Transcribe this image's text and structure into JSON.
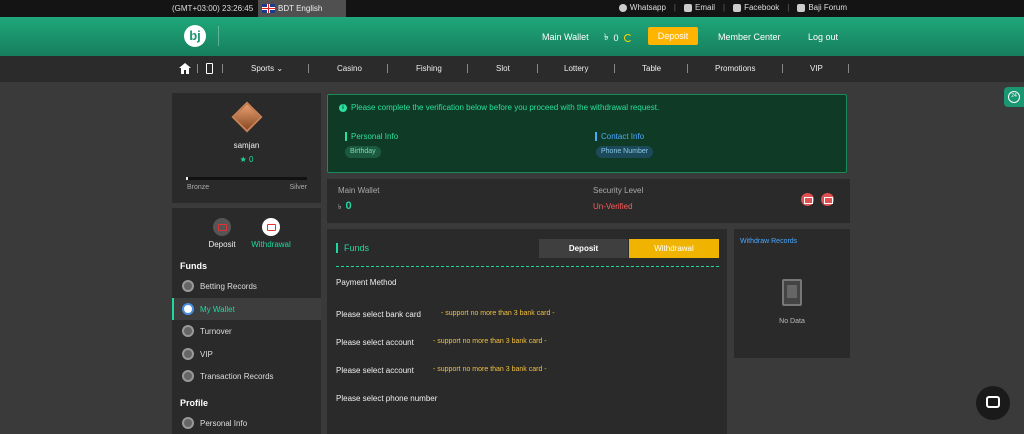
{
  "topbar": {
    "time": "(GMT+03:00) 23:26:45",
    "language": "BDT English",
    "links": [
      {
        "label": "Whatsapp",
        "icon": "whatsapp-icon"
      },
      {
        "label": "Email",
        "icon": "email-icon"
      },
      {
        "label": "Facebook",
        "icon": "facebook-icon"
      },
      {
        "label": "Baji Forum",
        "icon": "forum-icon"
      }
    ]
  },
  "header": {
    "logo": "bj",
    "main_wallet": "Main Wallet",
    "balance": "0",
    "deposit": "Deposit",
    "member_center": "Member Center",
    "logout": "Log out"
  },
  "nav": {
    "items": [
      "Sports",
      "Casino",
      "Fishing",
      "Slot",
      "Lottery",
      "Table",
      "Promotions",
      "VIP"
    ]
  },
  "sidebar": {
    "username": "samjan",
    "stars": "★ 0",
    "level_progress": 0.02,
    "level_from": "Bronze",
    "level_to": "Silver",
    "tabs": [
      {
        "label": "Deposit"
      },
      {
        "label": "Withdrawal"
      }
    ],
    "funds_title": "Funds",
    "funds_items": [
      {
        "label": "Betting Records"
      },
      {
        "label": "My Wallet"
      },
      {
        "label": "Turnover"
      },
      {
        "label": "VIP"
      },
      {
        "label": "Transaction Records"
      }
    ],
    "profile_title": "Profile",
    "profile_items": [
      {
        "label": "Personal Info"
      }
    ]
  },
  "verify": {
    "message": "Please complete the verification below before you proceed with the withdrawal request.",
    "personal_title": "Personal Info",
    "personal_pill": "Birthday",
    "contact_title": "Contact Info",
    "contact_pill": "Phone Number"
  },
  "wallet_bar": {
    "main_wallet": "Main Wallet",
    "currency": "৳",
    "balance": "0",
    "security_level": "Security Level",
    "security_status": "Un-Verified"
  },
  "funds": {
    "title": "Funds",
    "tab_deposit": "Deposit",
    "tab_withdrawal": "Withdrawal",
    "payment_method": "Payment Method",
    "rows": [
      {
        "label": "Please select bank card",
        "hint": "- support no more than 3 bank card -"
      },
      {
        "label": "Please select account",
        "hint": "- support no more than 3 bank card -"
      },
      {
        "label": "Please select account",
        "hint": "- support no more than 3 bank card -"
      },
      {
        "label": "Please select phone number",
        "hint": ""
      }
    ]
  },
  "records": {
    "title": "Withdraw Records",
    "empty": "No Data"
  },
  "float": {
    "support_24": "24"
  },
  "colors": {
    "accent": "#1fd8a0",
    "header_green": "#1a9670",
    "deposit_yellow": "#ffb400",
    "warning_red": "#ff5a5a"
  }
}
